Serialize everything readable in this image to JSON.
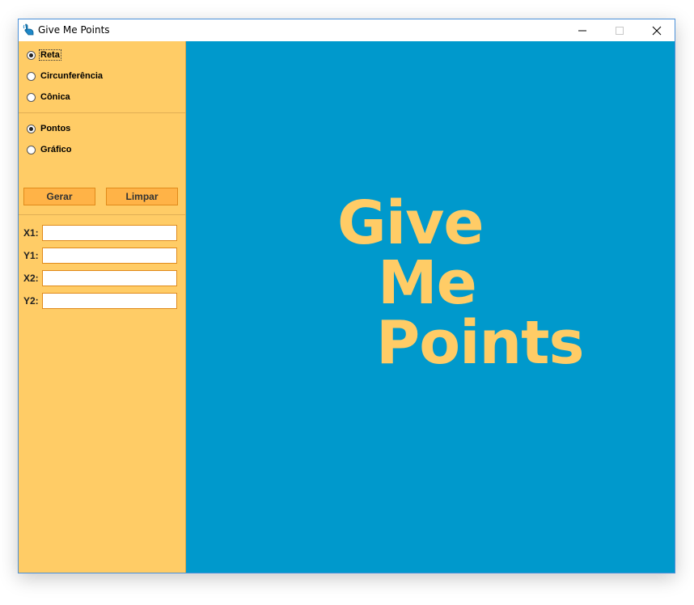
{
  "window": {
    "title": "Give Me Points",
    "controls": {
      "minimize_icon": "minimize-icon",
      "maximize_icon": "maximize-icon",
      "close_icon": "close-icon"
    }
  },
  "sidebar": {
    "shape_options": [
      {
        "label": "Reta",
        "checked": true
      },
      {
        "label": "Circunferência",
        "checked": false
      },
      {
        "label": "Cônica",
        "checked": false
      }
    ],
    "mode_options": [
      {
        "label": "Pontos",
        "checked": true
      },
      {
        "label": "Gráfico",
        "checked": false
      }
    ],
    "buttons": {
      "generate_label": "Gerar",
      "clear_label": "Limpar"
    },
    "fields": [
      {
        "label": "X1:",
        "value": ""
      },
      {
        "label": "Y1:",
        "value": ""
      },
      {
        "label": "X2:",
        "value": ""
      },
      {
        "label": "Y2:",
        "value": ""
      }
    ]
  },
  "canvas": {
    "logo_lines": [
      "Give",
      "Me",
      "Points"
    ]
  },
  "colors": {
    "sidebar_bg": "#ffcc66",
    "canvas_bg": "#0099cc",
    "logo_text": "#ffcc66",
    "button_bg": "#ffb347",
    "button_border": "#e08a1a"
  }
}
